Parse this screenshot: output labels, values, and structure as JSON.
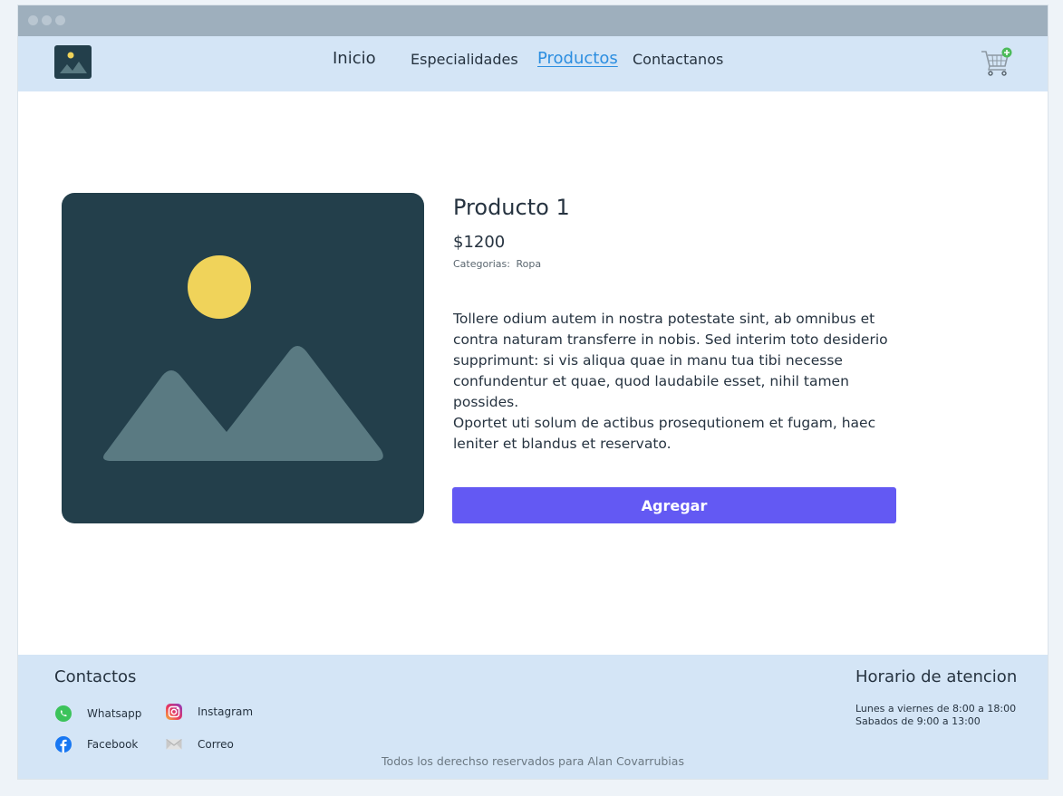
{
  "nav": {
    "links": [
      "Inicio",
      "Especialidades",
      "Productos",
      "Contactanos"
    ],
    "active": "Productos"
  },
  "product": {
    "title": "Producto 1",
    "price": "$1200",
    "categories_label": "Categorias:",
    "category": "Ropa",
    "paragraph_1": "Tollere odium autem in nostra potestate sint, ab omnibus et contra naturam transferre in nobis. Sed interim toto desiderio supprimunt: si vis aliqua quae in manu tua tibi necesse confundentur et quae, quod laudabile esset, nihil tamen possides.",
    "paragraph_2": "Oportet uti solum de actibus prosequtionem et fugam, haec leniter et blandus et reservato.",
    "add_button": "Agregar"
  },
  "footer": {
    "contacts_title": "Contactos",
    "contacts": [
      {
        "label": "Whatsapp",
        "icon": "whatsapp-icon"
      },
      {
        "label": "Instagram",
        "icon": "instagram-icon"
      },
      {
        "label": "Facebook",
        "icon": "facebook-icon"
      },
      {
        "label": "Correo",
        "icon": "mail-icon"
      }
    ],
    "hours_title": "Horario de atencion",
    "hours": [
      "Lunes a viernes de 8:00 a 18:00",
      "Sabados de 9:00 a 13:00"
    ],
    "copyright": "Todos los derechso reservados para Alan Covarrubias"
  },
  "colors": {
    "navbar_bg": "#d4e5f6",
    "accent_link": "#2c8ee0",
    "button": "#6359f3",
    "image_bg": "#233f4b",
    "sun": "#f0d35a",
    "mountains": "#5a7a82"
  }
}
